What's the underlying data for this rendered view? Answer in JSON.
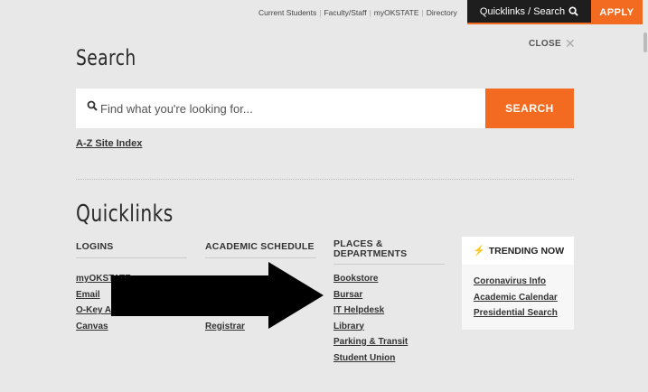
{
  "topnav": {
    "links": [
      "Current Students",
      "Faculty/Staff",
      "myOKSTATE",
      "Directory"
    ],
    "quicklinks_tab": "Quicklinks / Search",
    "apply_label": "APPLY"
  },
  "search": {
    "close_label": "CLOSE",
    "title": "Search",
    "placeholder": "Find what you're looking for...",
    "button_label": "SEARCH",
    "az_index": "A-Z Site Index"
  },
  "quicklinks": {
    "title": "Quicklinks",
    "logins": {
      "heading": "LOGINS",
      "items": [
        "myOKSTATE",
        "Email",
        "O-Key Account",
        "Canvas"
      ]
    },
    "academic_schedule": {
      "heading": "ACADEMIC SCHEDULE",
      "items": [
        "",
        "",
        "",
        "Registrar"
      ]
    },
    "places": {
      "heading": "PLACES & DEPARTMENTS",
      "items": [
        "Bookstore",
        "Bursar",
        "IT Helpdesk",
        "Library",
        "Parking & Transit",
        "Student Union"
      ]
    },
    "trending": {
      "heading": "TRENDING NOW",
      "items": [
        "Coronavirus Info",
        "Academic Calendar",
        "Presidential Search"
      ]
    }
  },
  "colors": {
    "accent": "#f26b21",
    "dark": "#1e1e1e",
    "background": "#e8e8e8"
  },
  "icons": {
    "search": "magnifier-icon",
    "close": "close-x-icon",
    "trending": "lightning-bolt-icon"
  }
}
